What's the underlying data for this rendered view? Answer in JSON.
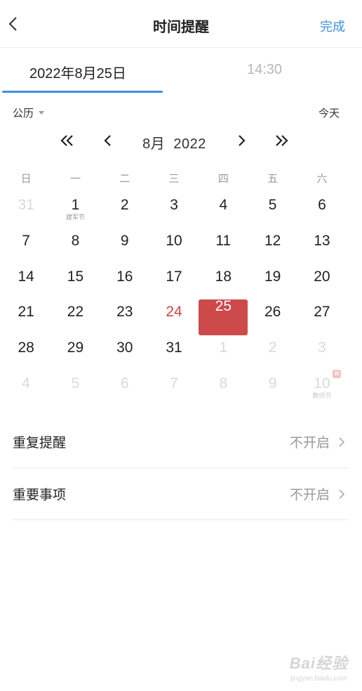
{
  "header": {
    "title": "时间提醒",
    "done_label": "完成"
  },
  "tabs": {
    "date": "2022年8月25日",
    "time": "14:30"
  },
  "toolbar": {
    "calendar_type": "公历",
    "today": "今天"
  },
  "month_nav": {
    "month": "8月",
    "year": "2022"
  },
  "weekdays": [
    "日",
    "一",
    "二",
    "三",
    "四",
    "五",
    "六"
  ],
  "days": [
    {
      "n": "31",
      "other": true
    },
    {
      "n": "1",
      "sub": "建军节"
    },
    {
      "n": "2"
    },
    {
      "n": "3"
    },
    {
      "n": "4"
    },
    {
      "n": "5"
    },
    {
      "n": "6"
    },
    {
      "n": "7"
    },
    {
      "n": "8"
    },
    {
      "n": "9"
    },
    {
      "n": "10"
    },
    {
      "n": "11"
    },
    {
      "n": "12"
    },
    {
      "n": "13"
    },
    {
      "n": "14"
    },
    {
      "n": "15"
    },
    {
      "n": "16"
    },
    {
      "n": "17"
    },
    {
      "n": "18"
    },
    {
      "n": "19"
    },
    {
      "n": "20"
    },
    {
      "n": "21"
    },
    {
      "n": "22"
    },
    {
      "n": "23"
    },
    {
      "n": "24",
      "holiday": true
    },
    {
      "n": "25",
      "selected": true
    },
    {
      "n": "26"
    },
    {
      "n": "27"
    },
    {
      "n": "28"
    },
    {
      "n": "29"
    },
    {
      "n": "30"
    },
    {
      "n": "31"
    },
    {
      "n": "1",
      "other": true
    },
    {
      "n": "2",
      "other": true
    },
    {
      "n": "3",
      "other": true
    },
    {
      "n": "4",
      "other": true
    },
    {
      "n": "5",
      "other": true
    },
    {
      "n": "6",
      "other": true
    },
    {
      "n": "7",
      "other": true
    },
    {
      "n": "8",
      "other": true
    },
    {
      "n": "9",
      "other": true
    },
    {
      "n": "10",
      "other": true,
      "sub": "教师节",
      "badge": "休"
    }
  ],
  "settings": {
    "repeat": {
      "label": "重复提醒",
      "value": "不开启"
    },
    "important": {
      "label": "重要事项",
      "value": "不开启"
    }
  },
  "watermark": {
    "logo": "Bai经验",
    "url": "jingyan.baidu.com"
  },
  "colors": {
    "accent": "#3f8fdc",
    "selected": "#cd4a4b",
    "holiday": "#c94a4a"
  }
}
